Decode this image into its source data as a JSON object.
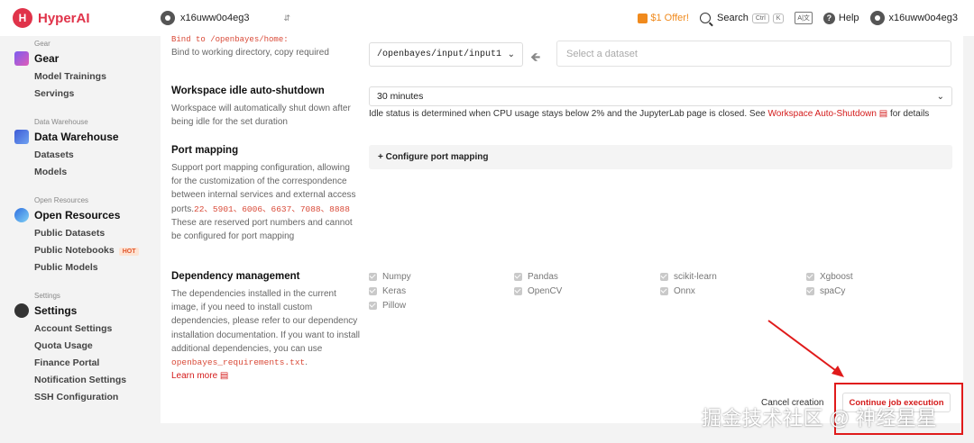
{
  "app": {
    "name": "HyperAI",
    "logo_letter": "H"
  },
  "topbar": {
    "workspace": "x16uww0o4eg3",
    "offer": "$1 Offer!",
    "search_label": "Search",
    "search_kbd1": "Ctrl",
    "search_kbd2": "K",
    "lang_icon": "A|文",
    "help_label": "Help",
    "user": "x16uww0o4eg3"
  },
  "sidebar": {
    "gear": {
      "caption": "Gear",
      "title": "Gear",
      "items": [
        "Model Trainings",
        "Servings"
      ]
    },
    "warehouse": {
      "caption": "Data Warehouse",
      "title": "Data Warehouse",
      "items": [
        "Datasets",
        "Models"
      ]
    },
    "resources": {
      "caption": "Open Resources",
      "title": "Open Resources",
      "items": [
        "Public Datasets",
        "Public Notebooks",
        "Public Models"
      ],
      "hot_badge": "HOT"
    },
    "settings": {
      "caption": "Settings",
      "title": "Settings",
      "items": [
        "Account Settings",
        "Quota Usage",
        "Finance Portal",
        "Notification Settings",
        "SSH Configuration"
      ]
    }
  },
  "form": {
    "bind": {
      "code": "Bind to /openbayes/home:",
      "desc": "Bind to working directory, copy required",
      "path": "/openbayes/input/input1",
      "dataset_placeholder": "Select a dataset"
    },
    "idle": {
      "title": "Workspace idle auto-shutdown",
      "desc": "Workspace will automatically shut down after being idle for the set duration",
      "value": "30 minutes",
      "hint_prefix": "Idle status is determined when CPU usage stays below 2% and the JupyterLab page is closed. See ",
      "hint_link": "Workspace Auto-Shutdown",
      "hint_suffix": " for details"
    },
    "port": {
      "title": "Port mapping",
      "desc_prefix": "Support port mapping configuration, allowing for the customization of the correspondence between internal services and external access ports.",
      "ports": "22、5901、6006、6637、7088、8888",
      "desc_suffix": " These are reserved port numbers and cannot be configured for port mapping",
      "button": "+ Configure port mapping"
    },
    "deps": {
      "title": "Dependency management",
      "desc_prefix": "The dependencies installed in the current image, if you need to install custom dependencies, please refer to our dependency installation documentation. If you want to install additional dependencies, you can use ",
      "file": "openbayes_requirements.txt",
      "desc_suffix": ".",
      "learn_more": "Learn more",
      "packages": [
        "Numpy",
        "Pandas",
        "scikit-learn",
        "Xgboost",
        "Keras",
        "OpenCV",
        "Onnx",
        "spaCy",
        "Pillow"
      ]
    },
    "cancel": "Cancel creation",
    "continue": "Continue job execution"
  },
  "watermark": "掘金技术社区 @ 神经星星",
  "colors": {
    "brand": "#e0334a",
    "link_red": "#d41b1b",
    "annotation": "#e01b1b"
  }
}
